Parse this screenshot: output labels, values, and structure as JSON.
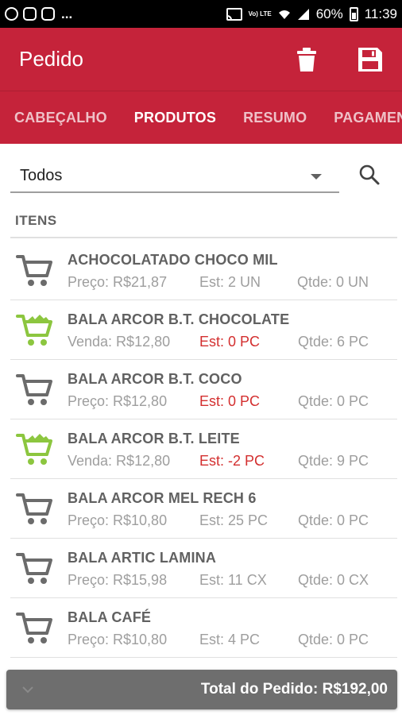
{
  "status_bar": {
    "battery": "60%",
    "time": "11:39",
    "volte": "Vo) LTE",
    "dots": "..."
  },
  "app_bar": {
    "title": "Pedido",
    "background_color": "#c5233a"
  },
  "tabs": [
    {
      "label": "CABEÇALHO",
      "active": false
    },
    {
      "label": "PRODUTOS",
      "active": true
    },
    {
      "label": "RESUMO",
      "active": false
    },
    {
      "label": "PAGAMEN",
      "active": false
    }
  ],
  "filter": {
    "selected": "Todos"
  },
  "section": {
    "title": "ITENS"
  },
  "items": [
    {
      "name": "ACHOCOLATADO CHOCO MIL",
      "price": "Preço: R$21,87",
      "stock": "Est: 2 UN",
      "qty": "Qtde: 0 UN",
      "in_cart": false,
      "stock_negative": false
    },
    {
      "name": "BALA ARCOR B.T. CHOCOLATE",
      "price": "Venda: R$12,80",
      "stock": "Est: 0 PC",
      "qty": "Qtde: 6 PC",
      "in_cart": true,
      "stock_negative": true
    },
    {
      "name": "BALA ARCOR B.T. COCO",
      "price": "Preço: R$12,80",
      "stock": "Est: 0 PC",
      "qty": "Qtde: 0 PC",
      "in_cart": false,
      "stock_negative": true
    },
    {
      "name": "BALA ARCOR B.T. LEITE",
      "price": "Venda: R$12,80",
      "stock": "Est: -2 PC",
      "qty": "Qtde: 9 PC",
      "in_cart": true,
      "stock_negative": true
    },
    {
      "name": "BALA ARCOR MEL RECH 6",
      "price": "Preço: R$10,80",
      "stock": "Est: 25 PC",
      "qty": "Qtde: 0 PC",
      "in_cart": false,
      "stock_negative": false
    },
    {
      "name": "BALA ARTIC LAMINA",
      "price": "Preço: R$15,98",
      "stock": "Est: 11 CX",
      "qty": "Qtde: 0 CX",
      "in_cart": false,
      "stock_negative": false
    },
    {
      "name": "BALA CAFÉ",
      "price": "Preço: R$10,80",
      "stock": "Est: 4 PC",
      "qty": "Qtde: 0 PC",
      "in_cart": false,
      "stock_negative": false
    }
  ],
  "colors": {
    "cart_empty": "#6b6b6b",
    "cart_full": "#8cc63f",
    "negative_stock": "#d32f2f"
  },
  "footer": {
    "total_label": "Total do Pedido: R$192,00"
  }
}
